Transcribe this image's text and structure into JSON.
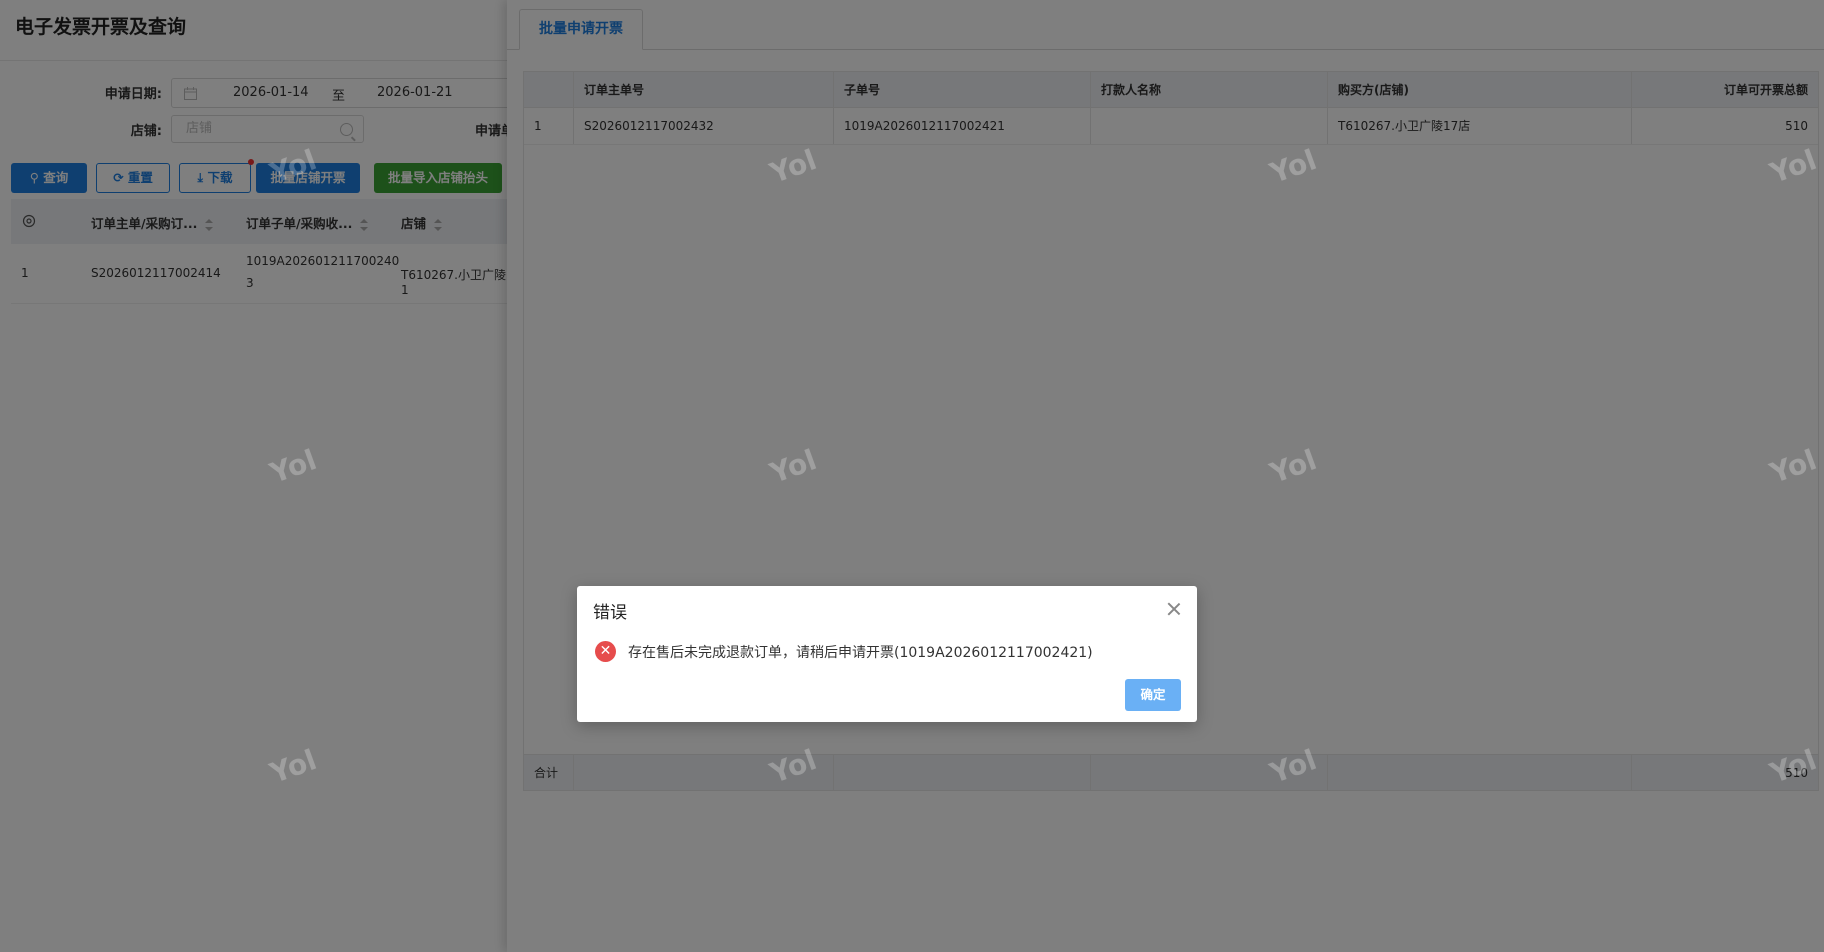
{
  "page": {
    "title": "电子发票开票及查询"
  },
  "filters": {
    "date_label": "申请日期:",
    "date_start": "2026-01-14",
    "date_sep": "至",
    "date_end": "2026-01-21",
    "shop_label": "店铺:",
    "shop_placeholder": "店铺",
    "apply_label": "申请单"
  },
  "toolbar": {
    "query": "查询",
    "reset": "重置",
    "download": "下载",
    "batch_shop_invoice": "批量店铺开票",
    "batch_import_header": "批量导入店铺抬头"
  },
  "left_table": {
    "headers": [
      "订单主单/采购订...",
      "订单子单/采购收...",
      "店铺"
    ],
    "row": {
      "index": "1",
      "main_order": "S2026012117002414",
      "sub_order_line1": "1019A202601211700240",
      "sub_order_line2": "3",
      "shop": "T610267.小卫广陵1"
    }
  },
  "drawer": {
    "tab": "批量申请开票",
    "headers": [
      "订单主单号",
      "子单号",
      "打款人名称",
      "购买方(店铺)",
      "订单可开票总额"
    ],
    "rows": [
      {
        "index": "1",
        "main_order": "S2026012117002432",
        "sub_order": "1019A2026012117002421",
        "payer": "",
        "buyer": "T610267.小卫广陵17店",
        "amount": "510"
      }
    ],
    "footer": {
      "label": "合计",
      "amount": "510"
    }
  },
  "watermark": "Yol",
  "modal": {
    "title": "错误",
    "message": "存在售后未完成退款订单，请稍后申请开票(1019A2026012117002421)",
    "ok": "确定"
  },
  "colors": {
    "primary": "#1e7fe0",
    "success": "#3aa234",
    "error": "#e64c4c",
    "ok_button": "#6ab0f5"
  }
}
